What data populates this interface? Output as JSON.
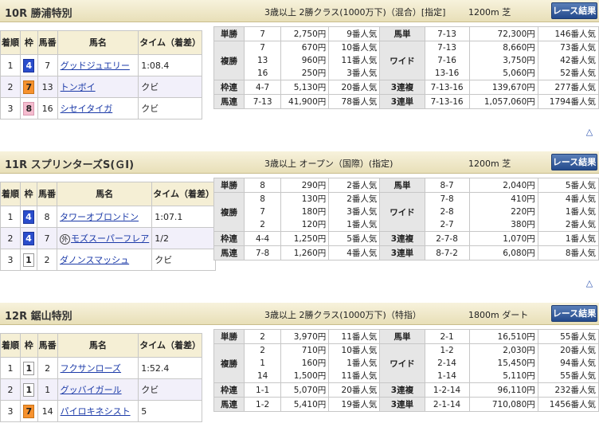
{
  "headers": {
    "pos": "着順",
    "frame": "枠",
    "no": "馬番",
    "name": "馬名",
    "time": "タイム（着差）"
  },
  "bet_labels": {
    "win": "単勝",
    "place": "複勝",
    "bracket": "枠連",
    "quinella": "馬連",
    "exacta": "馬単",
    "wide": "ワイド",
    "trio": "3連複",
    "trifecta": "3連単"
  },
  "button_label": "レース結果",
  "top_icon": "triangle-up-icon",
  "colors": {
    "frame1": "#ffffff",
    "frame4": "#2a4dcc",
    "frame7": "#f7922e",
    "frame8": "#f5bccf",
    "link": "#1b3aa8",
    "button": "#244a8c"
  },
  "races": [
    {
      "title": "10R 勝浦特別",
      "conditions": "3歳以上 2勝クラス(1000万下)（混合）[指定]",
      "distance": "1200m 芝",
      "results": [
        {
          "pos": "1",
          "frame": "4",
          "frame_class": "f4",
          "no": "7",
          "name": "グッドジュエリー",
          "foreign": "",
          "time": "1:08.4"
        },
        {
          "pos": "2",
          "frame": "7",
          "frame_class": "f7",
          "no": "13",
          "name": "トンボイ",
          "foreign": "",
          "time": "クビ"
        },
        {
          "pos": "3",
          "frame": "8",
          "frame_class": "f8",
          "no": "16",
          "name": "シセイタイガ",
          "foreign": "",
          "time": "クビ"
        }
      ],
      "win": {
        "comb": "7",
        "pay": "2,750円",
        "pop": "9番人気"
      },
      "place": {
        "comb": [
          "7",
          "13",
          "16"
        ],
        "pay": [
          "670円",
          "960円",
          "250円"
        ],
        "pop": [
          "10番人気",
          "11番人気",
          "3番人気"
        ]
      },
      "bracket": {
        "comb": "4-7",
        "pay": "5,130円",
        "pop": "20番人気"
      },
      "quinella": {
        "comb": "7-13",
        "pay": "41,900円",
        "pop": "78番人気"
      },
      "exacta": {
        "comb": "7-13",
        "pay": "72,300円",
        "pop": "146番人気"
      },
      "wide": {
        "comb": [
          "7-13",
          "7-16",
          "13-16"
        ],
        "pay": [
          "8,660円",
          "3,750円",
          "5,060円"
        ],
        "pop": [
          "73番人気",
          "42番人気",
          "52番人気"
        ]
      },
      "trio": {
        "comb": "7-13-16",
        "pay": "139,670円",
        "pop": "277番人気"
      },
      "trifecta": {
        "comb": "7-13-16",
        "pay": "1,057,060円",
        "pop": "1794番人気"
      }
    },
    {
      "title": "11R スプリンターズS(ＧⅠ)",
      "conditions": "3歳以上 オープン（国際）(指定)",
      "distance": "1200m 芝",
      "results": [
        {
          "pos": "1",
          "frame": "4",
          "frame_class": "f4",
          "no": "8",
          "name": "タワーオブロンドン",
          "foreign": "",
          "time": "1:07.1"
        },
        {
          "pos": "2",
          "frame": "4",
          "frame_class": "f4",
          "no": "7",
          "name": "モズスーパーフレア",
          "foreign": "外",
          "time": "1/2"
        },
        {
          "pos": "3",
          "frame": "1",
          "frame_class": "f1",
          "no": "2",
          "name": "ダノンスマッシュ",
          "foreign": "",
          "time": "クビ"
        }
      ],
      "win": {
        "comb": "8",
        "pay": "290円",
        "pop": "2番人気"
      },
      "place": {
        "comb": [
          "8",
          "7",
          "2"
        ],
        "pay": [
          "130円",
          "180円",
          "120円"
        ],
        "pop": [
          "2番人気",
          "3番人気",
          "1番人気"
        ]
      },
      "bracket": {
        "comb": "4-4",
        "pay": "1,250円",
        "pop": "5番人気"
      },
      "quinella": {
        "comb": "7-8",
        "pay": "1,260円",
        "pop": "4番人気"
      },
      "exacta": {
        "comb": "8-7",
        "pay": "2,040円",
        "pop": "5番人気"
      },
      "wide": {
        "comb": [
          "7-8",
          "2-8",
          "2-7"
        ],
        "pay": [
          "410円",
          "220円",
          "380円"
        ],
        "pop": [
          "4番人気",
          "1番人気",
          "2番人気"
        ]
      },
      "trio": {
        "comb": "2-7-8",
        "pay": "1,070円",
        "pop": "1番人気"
      },
      "trifecta": {
        "comb": "8-7-2",
        "pay": "6,080円",
        "pop": "8番人気"
      }
    },
    {
      "title": "12R 鋸山特別",
      "conditions": "3歳以上 2勝クラス(1000万下)（特指）",
      "distance": "1800m ダート",
      "results": [
        {
          "pos": "1",
          "frame": "1",
          "frame_class": "f1",
          "no": "2",
          "name": "フクサンローズ",
          "foreign": "",
          "time": "1:52.4"
        },
        {
          "pos": "2",
          "frame": "1",
          "frame_class": "f1",
          "no": "1",
          "name": "グッバイガール",
          "foreign": "",
          "time": "クビ"
        },
        {
          "pos": "3",
          "frame": "7",
          "frame_class": "f7",
          "no": "14",
          "name": "パイロキネシスト",
          "foreign": "",
          "time": "5"
        }
      ],
      "win": {
        "comb": "2",
        "pay": "3,970円",
        "pop": "11番人気"
      },
      "place": {
        "comb": [
          "2",
          "1",
          "14"
        ],
        "pay": [
          "710円",
          "160円",
          "1,500円"
        ],
        "pop": [
          "10番人気",
          "1番人気",
          "11番人気"
        ]
      },
      "bracket": {
        "comb": "1-1",
        "pay": "5,070円",
        "pop": "20番人気"
      },
      "quinella": {
        "comb": "1-2",
        "pay": "5,410円",
        "pop": "19番人気"
      },
      "exacta": {
        "comb": "2-1",
        "pay": "16,510円",
        "pop": "55番人気"
      },
      "wide": {
        "comb": [
          "1-2",
          "2-14",
          "1-14"
        ],
        "pay": [
          "2,030円",
          "15,450円",
          "5,110円"
        ],
        "pop": [
          "20番人気",
          "94番人気",
          "55番人気"
        ]
      },
      "trio": {
        "comb": "1-2-14",
        "pay": "96,110円",
        "pop": "232番人気"
      },
      "trifecta": {
        "comb": "2-1-14",
        "pay": "710,080円",
        "pop": "1456番人気"
      }
    }
  ]
}
